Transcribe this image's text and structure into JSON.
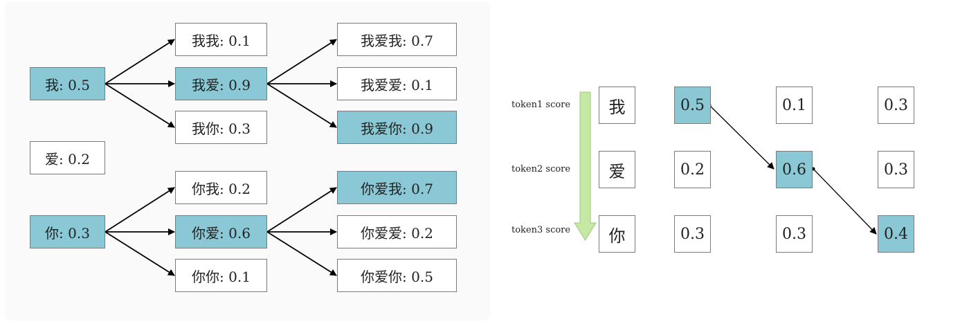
{
  "beam_tree": {
    "roots": [
      {
        "label": "我: 0.5",
        "highlight": true
      },
      {
        "label": "爱: 0.2",
        "highlight": false
      },
      {
        "label": "你: 0.3",
        "highlight": true
      }
    ],
    "level2": [
      {
        "label": "我我: 0.1",
        "highlight": false
      },
      {
        "label": "我爱: 0.9",
        "highlight": true
      },
      {
        "label": "我你: 0.3",
        "highlight": false
      },
      {
        "label": "你我: 0.2",
        "highlight": false
      },
      {
        "label": "你爱: 0.6",
        "highlight": true
      },
      {
        "label": "你你: 0.1",
        "highlight": false
      }
    ],
    "level3": [
      {
        "label": "我爱我: 0.7",
        "highlight": false
      },
      {
        "label": "我爱爱: 0.1",
        "highlight": false
      },
      {
        "label": "我爱你: 0.9",
        "highlight": true
      },
      {
        "label": "你爱我: 0.7",
        "highlight": true
      },
      {
        "label": "你爱爱: 0.2",
        "highlight": false
      },
      {
        "label": "你爱你: 0.5",
        "highlight": false
      }
    ]
  },
  "greedy": {
    "row_labels": [
      "token1 score",
      "token2 score",
      "token3 score"
    ],
    "tokens": [
      "我",
      "爱",
      "你"
    ],
    "steps": [
      [
        {
          "value": "0.5",
          "highlight": true
        },
        {
          "value": "0.2",
          "highlight": false
        },
        {
          "value": "0.3",
          "highlight": false
        }
      ],
      [
        {
          "value": "0.1",
          "highlight": false
        },
        {
          "value": "0.6",
          "highlight": true
        },
        {
          "value": "0.3",
          "highlight": false
        }
      ],
      [
        {
          "value": "0.3",
          "highlight": false
        },
        {
          "value": "0.3",
          "highlight": false
        },
        {
          "value": "0.4",
          "highlight": true
        }
      ]
    ]
  },
  "colors": {
    "highlight": "#89c8d4",
    "arrow_fill": "#c5e8a5",
    "border": "#7a7a7a"
  }
}
